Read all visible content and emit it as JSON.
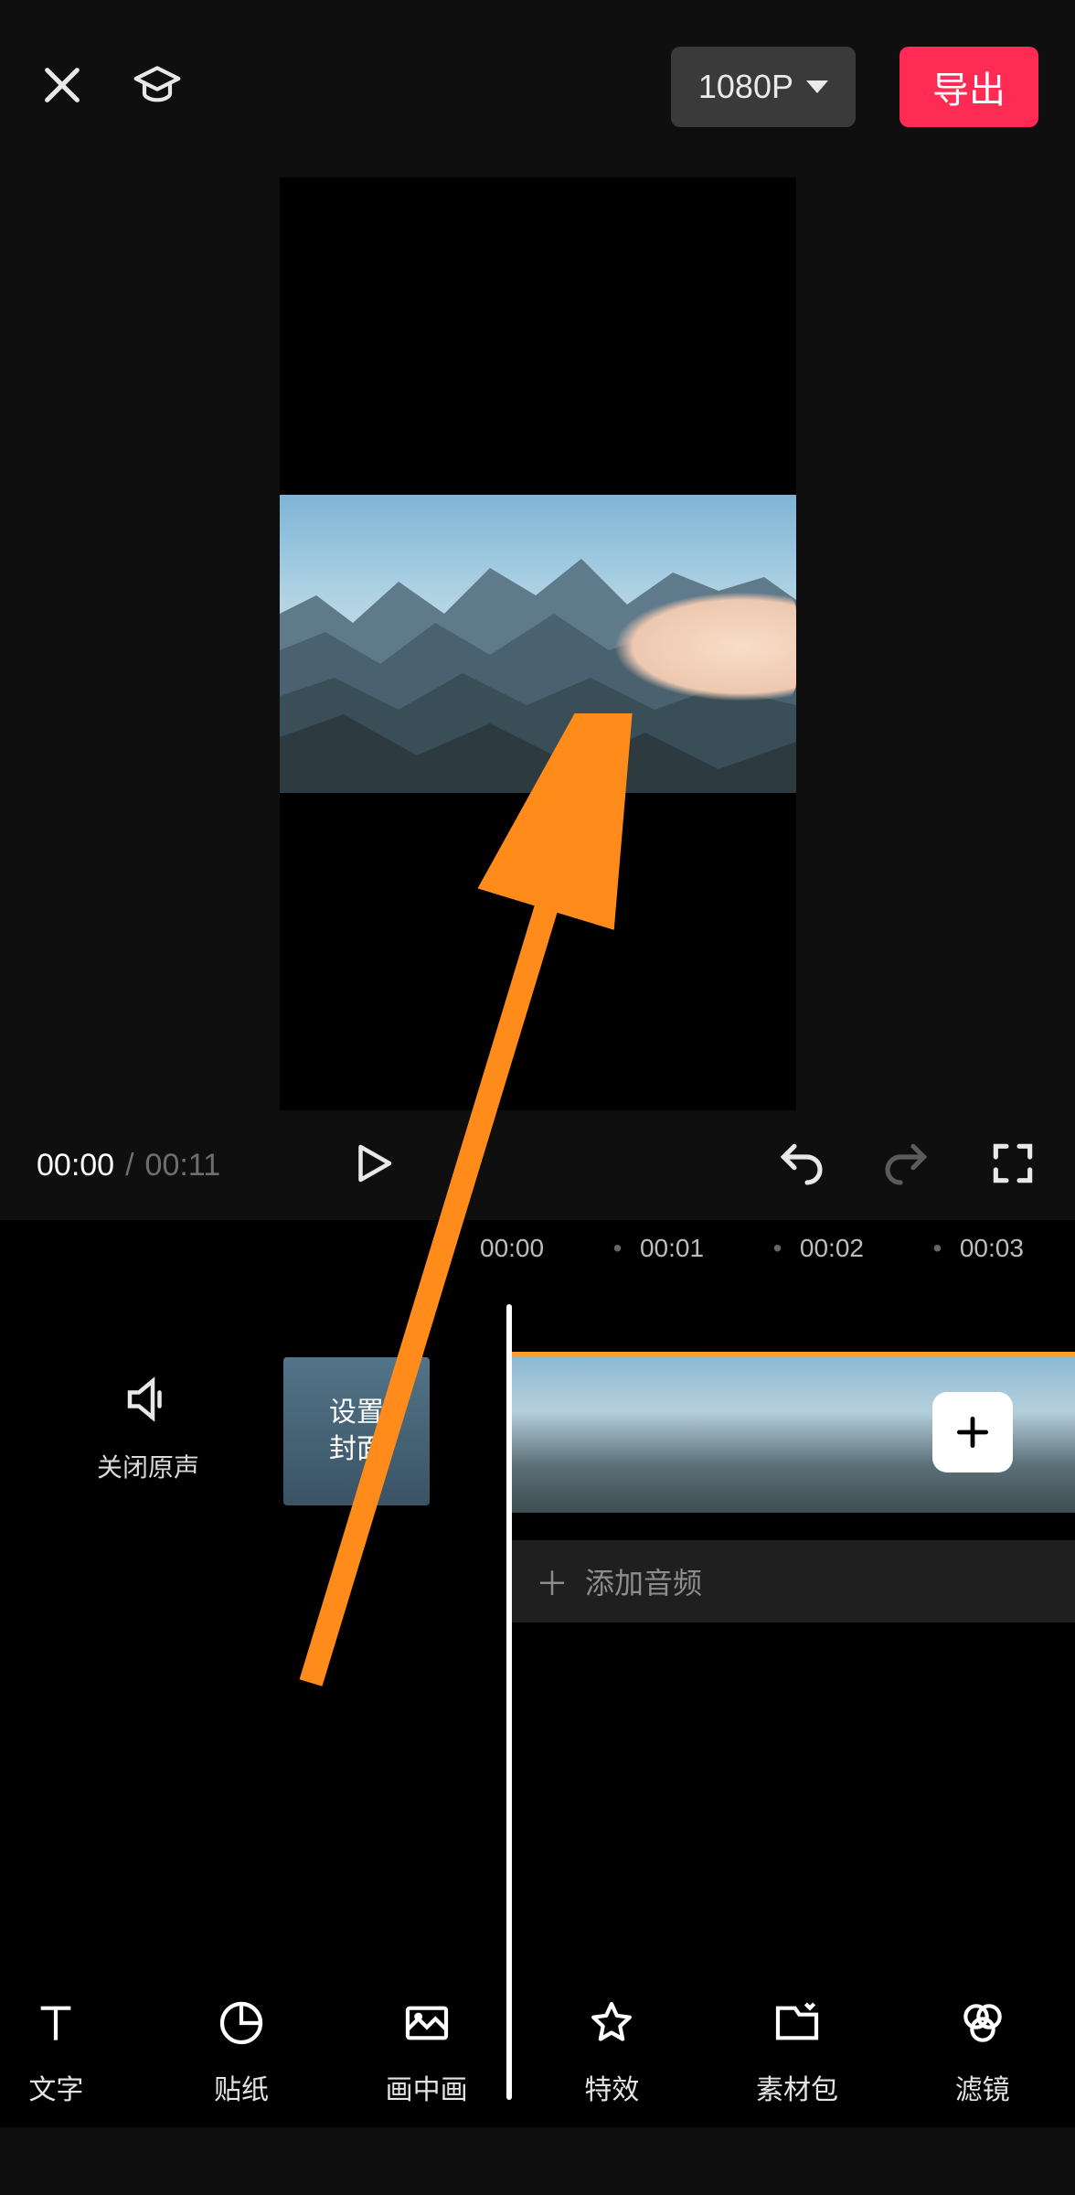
{
  "header": {
    "resolution_label": "1080P",
    "export_label": "导出"
  },
  "playback": {
    "current_time": "00:00",
    "separator": "/",
    "total_time": "00:11"
  },
  "ruler_ticks": [
    "00:00",
    "00:01",
    "00:02",
    "00:03"
  ],
  "timeline": {
    "mute_label": "关闭原声",
    "cover_label_line1": "设置",
    "cover_label_line2": "封面",
    "add_audio_label": "添加音频"
  },
  "toolbar": [
    {
      "icon": "text-icon",
      "label": "文字"
    },
    {
      "icon": "sticker-icon",
      "label": "贴纸"
    },
    {
      "icon": "pip-icon",
      "label": "画中画"
    },
    {
      "icon": "effects-icon",
      "label": "特效"
    },
    {
      "icon": "assets-icon",
      "label": "素材包"
    },
    {
      "icon": "filter-icon",
      "label": "滤镜"
    }
  ]
}
